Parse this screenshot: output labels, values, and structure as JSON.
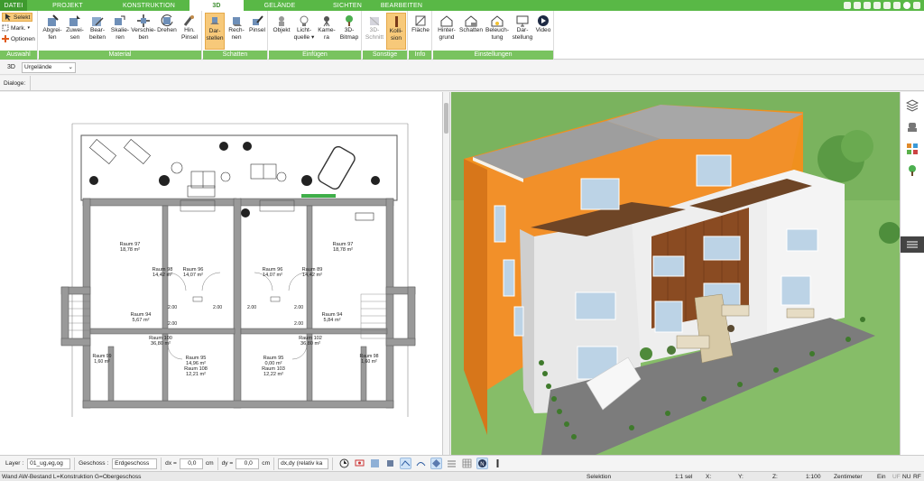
{
  "tabs": [
    {
      "label": "DATEI"
    },
    {
      "label": "PROJEKT"
    },
    {
      "label": "KONSTRUKTION"
    },
    {
      "label": "3D"
    },
    {
      "label": "GELÄNDE"
    },
    {
      "label": "SICHTEN"
    },
    {
      "label": "BEARBEITEN"
    }
  ],
  "active_tab": "3D",
  "ribbon": {
    "auswahl": {
      "label": "Auswahl",
      "selekt": "Selekt",
      "mark": "Mark.",
      "optionen": "Optionen"
    },
    "material": {
      "label": "Material",
      "buttons": [
        "Abgrei-\nfen",
        "Zuwei-\nsen",
        "Bear-\nbeiten",
        "Skalie-\nren",
        "Verschie-\nben",
        "Drehen",
        "Hin.\nPinsel"
      ]
    },
    "schatten": {
      "label": "Schatten",
      "buttons": [
        "Dar-\nstellen",
        "Rech-\nnen",
        "Pinsel"
      ]
    },
    "einfuegen": {
      "label": "Einfügen",
      "buttons": [
        "Objekt",
        "Licht-\nquelle ▾",
        "Kame-\nra",
        "3D-\nBitmap"
      ]
    },
    "sonstige": {
      "label": "Sonstige",
      "buttons": [
        "3D-\nSchnitt",
        "Kolli-\nsion"
      ]
    },
    "info": {
      "label": "Info",
      "buttons": [
        "Fläche"
      ]
    },
    "einstellungen": {
      "label": "Einstellungen",
      "buttons": [
        "Hinter-\ngrund",
        "Schatten",
        "Beleuch-\ntung",
        "Dar-\nstellung",
        "Video"
      ]
    }
  },
  "row1": {
    "label": "3D",
    "combo": "Urgelände"
  },
  "row2": {
    "label": "Dialoge:"
  },
  "plan": {
    "rooms": [
      {
        "name": "Raum 97",
        "area": "18,78 m²"
      },
      {
        "name": "Raum 98",
        "area": "14,42 m²"
      },
      {
        "name": "Raum 96",
        "area": "14,07 m²"
      },
      {
        "name": "Raum 96",
        "area": "14,07 m²"
      },
      {
        "name": "Raum 89",
        "area": "14,42 m²"
      },
      {
        "name": "Raum 97",
        "area": "18,78 m²"
      },
      {
        "name": "Raum 94",
        "area": "5,67 m²"
      },
      {
        "name": "Raum 94",
        "area": "5,84 m²"
      },
      {
        "name": "Raum 100",
        "area": "36,80 m²"
      },
      {
        "name": "Raum 102",
        "area": "36,80 m²"
      },
      {
        "name": "Raum 95",
        "area": "14,96 m²"
      },
      {
        "name": "Raum 108",
        "area": "12,21 m²"
      },
      {
        "name": "Raum 95",
        "area": "0,00 m²"
      },
      {
        "name": "Raum 103",
        "area": "12,22 m²"
      },
      {
        "name": "Raum 99",
        "area": "1,60 m²"
      },
      {
        "name": "Raum 98",
        "area": "1,60 m²"
      }
    ],
    "dims": [
      "2.00",
      "2.00",
      "2.00",
      "2.00",
      "2.00",
      "2.00"
    ]
  },
  "bottombar": {
    "layer_label": "Layer :",
    "layer_value": "01_ug,eg,og",
    "geschoss_label": "Geschoss :",
    "geschoss_value": "Erdgeschoss",
    "dx_label": "dx =",
    "dx_value": "0,0",
    "dx_unit": "cm",
    "dy_label": "dy =",
    "dy_value": "0,0",
    "dy_unit": "cm",
    "mode_value": "dx,dy (relativ ka"
  },
  "status": {
    "left": "Wand AW-Bestand L=Konstruktion G=Obergeschoss",
    "mode": "Selektion",
    "scale_sel": "1:1 sel",
    "x": "X:",
    "y": "Y:",
    "z": "Z:",
    "scale": "1:100",
    "unit": "Zentimeter",
    "ein": "Ein",
    "uf": "UF",
    "nu": "NU",
    "rf": "RF"
  },
  "colors": {
    "accent": "#59b846",
    "group_label": "#79c35f",
    "active_button": "#f7c97a",
    "facade_orange": "#f08a28",
    "lawn": "#8ec46f"
  }
}
